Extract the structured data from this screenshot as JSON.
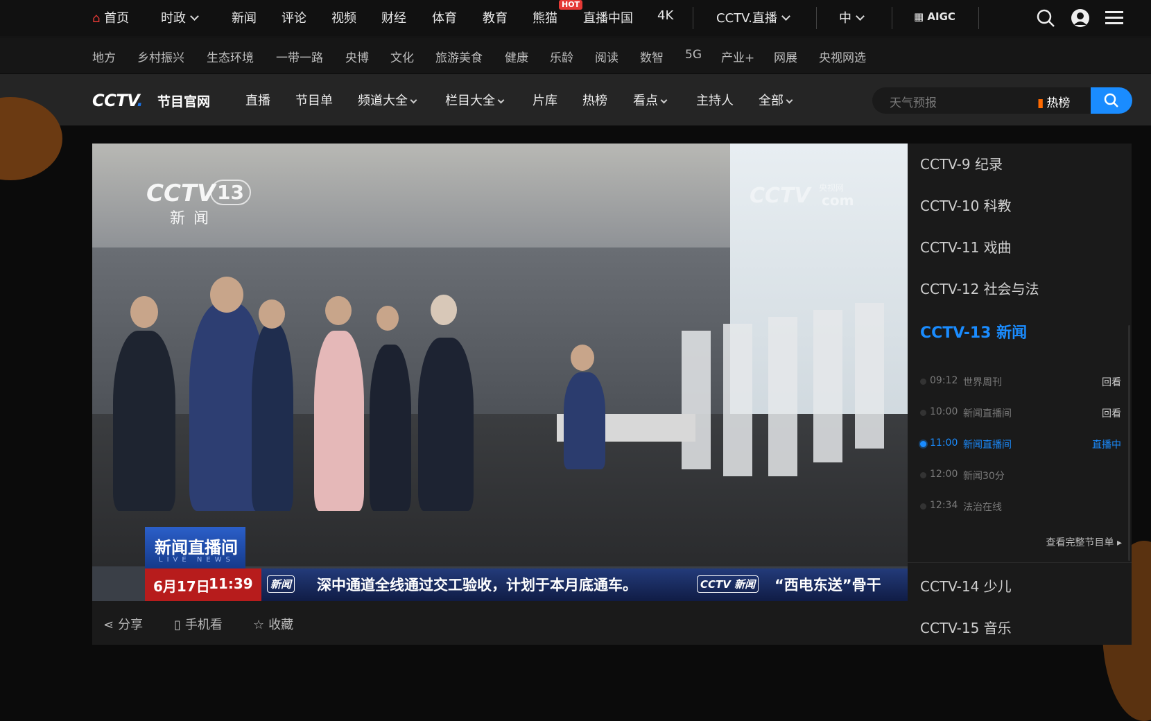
{
  "top_nav": {
    "home": "首页",
    "items": [
      "时政",
      "新闻",
      "评论",
      "视频",
      "财经",
      "体育",
      "教育",
      "熊猫",
      "直播中国",
      "4K"
    ],
    "hot_badge": "HOT",
    "live": "CCTV.直播",
    "lang": "中",
    "aigc": "AIGC"
  },
  "sub_nav": [
    "地方",
    "乡村振兴",
    "生态环境",
    "一带一路",
    "央博",
    "文化",
    "旅游美食",
    "健康",
    "乐龄",
    "阅读",
    "数智",
    "5G",
    "产业+",
    "网展",
    "央视网选"
  ],
  "channel_bar": {
    "logo": "CCTV",
    "logo_sub": "节目官网",
    "items": [
      "直播",
      "节目单",
      "频道大全",
      "栏目大全",
      "片库",
      "热榜",
      "看点",
      "主持人",
      "全部"
    ],
    "search_placeholder": "天气预报",
    "hot_rank": "热榜"
  },
  "player": {
    "channel_logo": "CCTV",
    "channel_num": "13",
    "channel_name": "新闻",
    "watermark": "CCTV",
    "watermark_sub": "央视网",
    "watermark_domain": "com",
    "program_tag": "新闻直播间",
    "program_tag_en": "LIVE NEWS",
    "date": "6月17日",
    "time": "11:39",
    "ticker_tag": "新闻",
    "ticker_text": "深中通道全线通过交工验收，计划于本月底通车。",
    "ticker_tag2": "CCTV 新闻",
    "ticker_text2": "“西电东送”骨干"
  },
  "actions": {
    "share": "分享",
    "mobile": "手机看",
    "favorite": "收藏"
  },
  "sidebar": {
    "channels_top": [
      "CCTV-9 纪录",
      "CCTV-10 科教",
      "CCTV-11 戏曲",
      "CCTV-12 社会与法"
    ],
    "active_channel": "CCTV-13 新闻",
    "programs": [
      {
        "time": "09:12",
        "name": "世界周刊",
        "status": "回看"
      },
      {
        "time": "10:00",
        "name": "新闻直播间",
        "status": "回看"
      },
      {
        "time": "11:00",
        "name": "新闻直播间",
        "status": "直播中"
      },
      {
        "time": "12:00",
        "name": "新闻30分",
        "status": ""
      },
      {
        "time": "12:34",
        "name": "法治在线",
        "status": ""
      }
    ],
    "full_schedule": "查看完整节目单 ▸",
    "channels_bottom": [
      "CCTV-14 少儿",
      "CCTV-15 音乐"
    ]
  }
}
